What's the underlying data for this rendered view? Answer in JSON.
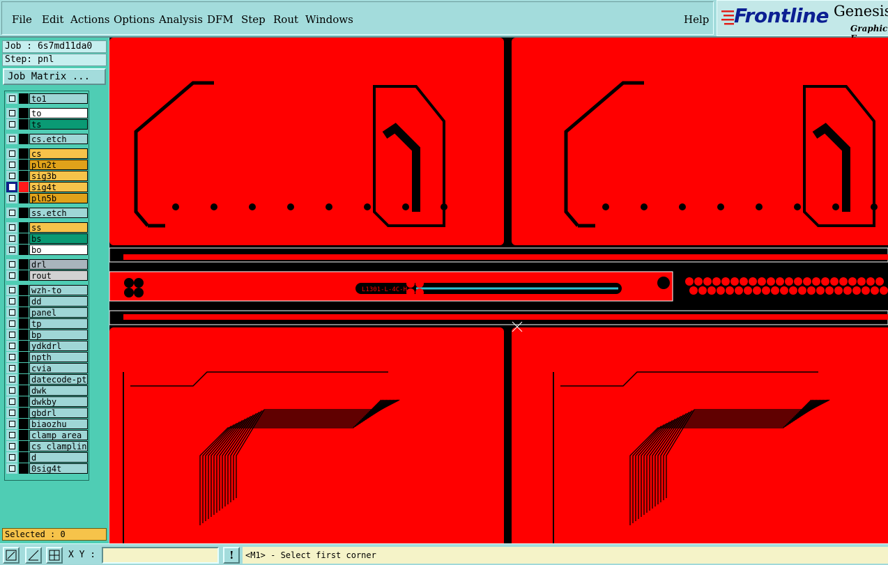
{
  "menu": {
    "file": "File",
    "edit": "Edit",
    "actions": "Actions",
    "options": "Options",
    "analysis": "Analysis",
    "dfm": "DFM",
    "step": "Step",
    "rout": "Rout",
    "windows": "Windows",
    "help": "Help"
  },
  "logo": {
    "brand": "Frontline",
    "product": "Genesis",
    "subtitle": "Graphic E"
  },
  "job": {
    "job_label": "Job : 6s7md11da0",
    "step_label": "Step: pnl",
    "matrix_button": "Job Matrix ..."
  },
  "layers": [
    {
      "name": "to1",
      "color": "#9fd6d6"
    },
    {
      "name": "to",
      "color": "#ffffff"
    },
    {
      "name": "ts",
      "color": "#0a9a74"
    },
    {
      "name": "cs.etch",
      "color": "#9fd6d6"
    },
    {
      "name": "cs",
      "color": "#f6c34a"
    },
    {
      "name": "pln2t",
      "color": "#e0a21a"
    },
    {
      "name": "sig3b",
      "color": "#f6c34a"
    },
    {
      "name": "sig4t",
      "color": "#f6c34a"
    },
    {
      "name": "pln5b",
      "color": "#e0a21a"
    },
    {
      "name": "ss.etch",
      "color": "#9fd6d6"
    },
    {
      "name": "ss",
      "color": "#f6c34a"
    },
    {
      "name": "bs",
      "color": "#0a9a74"
    },
    {
      "name": "bo",
      "color": "#ffffff"
    },
    {
      "name": "drl",
      "color": "#a9b5bd"
    },
    {
      "name": "rout",
      "color": "#d2d2d2"
    },
    {
      "name": "wzh-to",
      "color": "#9fd6d6"
    },
    {
      "name": "dd",
      "color": "#9fd6d6"
    },
    {
      "name": "panel",
      "color": "#9fd6d6"
    },
    {
      "name": "tp",
      "color": "#9fd6d6"
    },
    {
      "name": "bp",
      "color": "#9fd6d6"
    },
    {
      "name": "ydkdrl",
      "color": "#9fd6d6"
    },
    {
      "name": "npth",
      "color": "#9fd6d6"
    },
    {
      "name": "cvia",
      "color": "#9fd6d6"
    },
    {
      "name": "datecode-pte",
      "color": "#9fd6d6"
    },
    {
      "name": "dwk",
      "color": "#9fd6d6"
    },
    {
      "name": "dwkby",
      "color": "#9fd6d6"
    },
    {
      "name": "gbdrl",
      "color": "#9fd6d6"
    },
    {
      "name": "biaozhu",
      "color": "#9fd6d6"
    },
    {
      "name": "clamp_area",
      "color": "#9fd6d6"
    },
    {
      "name": "cs_clampline",
      "color": "#9fd6d6"
    },
    {
      "name": "d",
      "color": "#9fd6d6"
    },
    {
      "name": "0sig4t",
      "color": "#9fd6d6"
    }
  ],
  "active_layer": "sig4t",
  "selected": "Selected : 0",
  "status": {
    "xy_label": "X Y :",
    "xy_value": "",
    "message": "<M1> - Select first corner",
    "alert_glyph": "!"
  },
  "board_text": "L1301-L-4C-H"
}
